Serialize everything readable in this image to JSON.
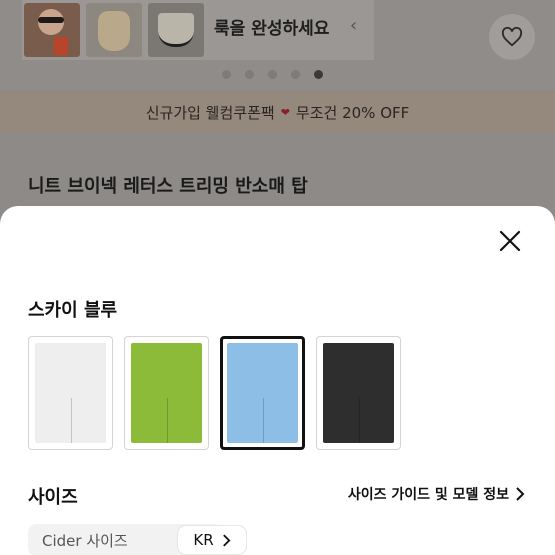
{
  "carousel": {
    "promo_title": "룩을 완성하세요",
    "thumbnails": [
      "model-with-sunglasses",
      "beige-bag",
      "pleated-skirt"
    ],
    "dots_total": 5,
    "dots_active_index": 4
  },
  "banner": {
    "text_left": "신규가입 웰컴쿠폰팩",
    "text_right": "무조건 20% OFF"
  },
  "product": {
    "title": "니트 브이넥 레터스 트리밍 반소매 탑"
  },
  "sheet": {
    "selected_color": "스카이 블루",
    "swatches": [
      {
        "color": "#f1f1f1",
        "selected": false
      },
      {
        "color": "#8cbb3a",
        "selected": false
      },
      {
        "color": "#8dbfe6",
        "selected": true
      },
      {
        "color": "#2e2e2e",
        "selected": false
      }
    ],
    "size_label": "사이즈",
    "size_guide": "사이즈 가이드 및 모델 정보",
    "cider_size_label": "Cider 사이즈",
    "region": "KR"
  },
  "icons": {
    "heart": "heart-icon",
    "close": "close-icon",
    "chevron_right": "chevron-right-icon",
    "chevron_left": "chevron-left-icon"
  }
}
